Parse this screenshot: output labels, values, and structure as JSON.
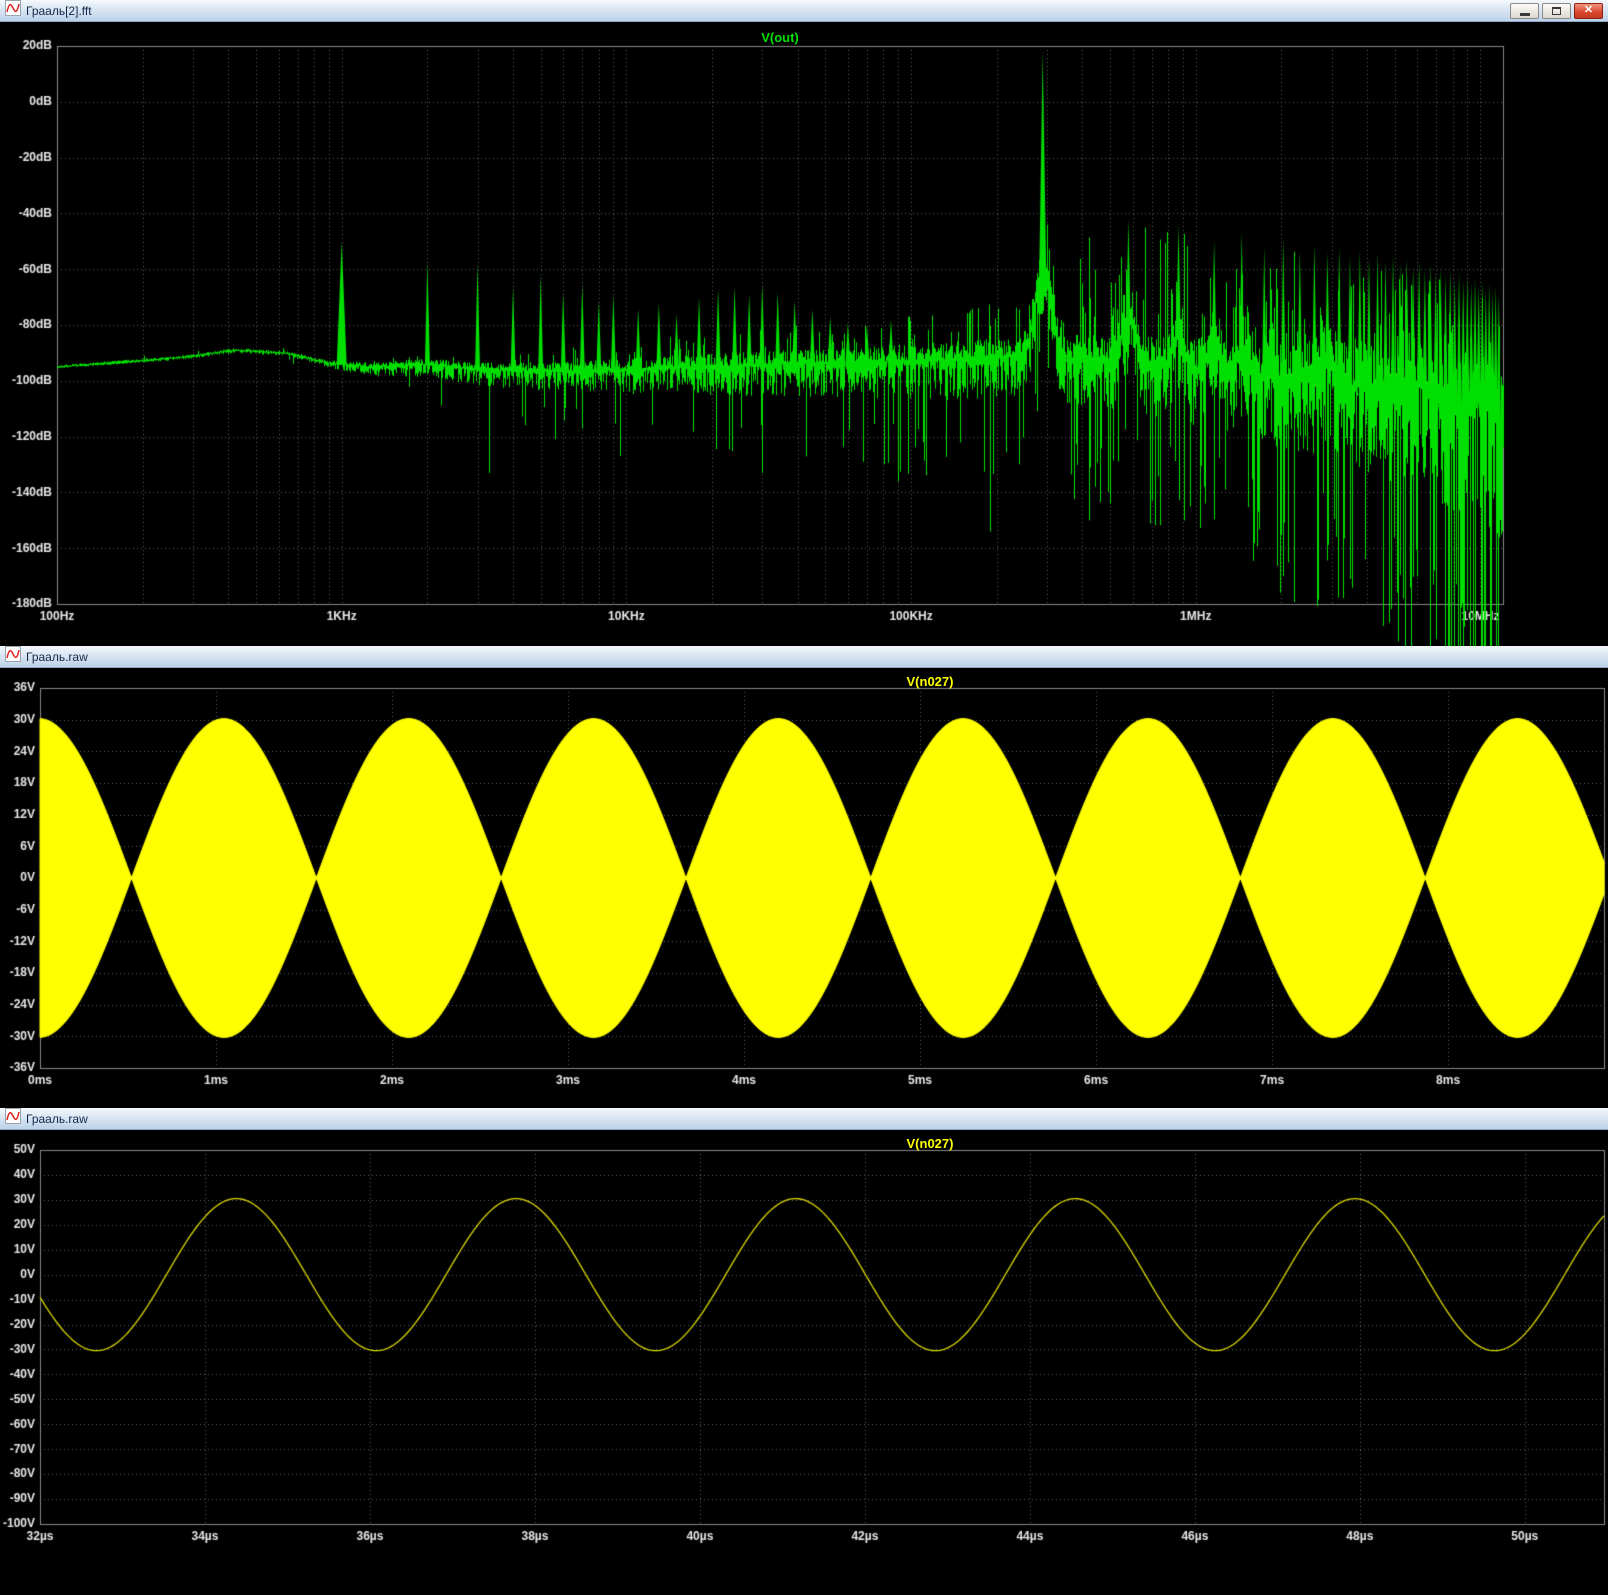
{
  "windows": [
    {
      "title": "Грааль[2].fft"
    },
    {
      "title": "Грааль.raw"
    },
    {
      "title": "Грааль.raw"
    }
  ],
  "window_controls": {
    "close_glyph": "✕"
  },
  "icons": {
    "titlebar": "waveform-icon",
    "minimize": "minimize-icon",
    "restore": "restore-icon",
    "close": "close-icon"
  },
  "chart_data": [
    {
      "type": "line",
      "title": "V(out)",
      "color": "#00e000",
      "x_scale": "log",
      "x_tick_labels": [
        "100Hz",
        "1KHz",
        "10KHz",
        "100KHz",
        "1MHz",
        "10MHz"
      ],
      "x_tick_hz": [
        100,
        1000,
        10000,
        100000,
        1000000,
        10000000
      ],
      "x_range_hz": [
        100,
        12000000
      ],
      "y_tick_labels": [
        "20dB",
        "0dB",
        "-20dB",
        "-40dB",
        "-60dB",
        "-80dB",
        "-100dB",
        "-120dB",
        "-140dB",
        "-160dB",
        "-180dB"
      ],
      "y_tick_db": [
        20,
        0,
        -20,
        -40,
        -60,
        -80,
        -100,
        -120,
        -140,
        -160,
        -180
      ],
      "y_range_db": [
        -180,
        20
      ],
      "grid": "dotted",
      "legend_position": "top-center",
      "carrier_hz": 290000,
      "carrier_db": 18,
      "low_harmonics_hz_db": [
        [
          1000,
          -50
        ],
        [
          2000,
          -57
        ],
        [
          3000,
          -58
        ],
        [
          4000,
          -66
        ],
        [
          5000,
          -62
        ],
        [
          6000,
          -68
        ],
        [
          7000,
          -65
        ],
        [
          8000,
          -71
        ],
        [
          9000,
          -69
        ],
        [
          11000,
          -74
        ],
        [
          13000,
          -72
        ],
        [
          15000,
          -76
        ],
        [
          18000,
          -70
        ],
        [
          21000,
          -67
        ],
        [
          24000,
          -66
        ],
        [
          27000,
          -69
        ],
        [
          30000,
          -65
        ],
        [
          34000,
          -68
        ],
        [
          39000,
          -71
        ],
        [
          45000,
          -74
        ],
        [
          52000,
          -77
        ],
        [
          60000,
          -79
        ],
        [
          70000,
          -80
        ],
        [
          85000,
          -78
        ]
      ],
      "carrier_harmonics_hz_db": [
        [
          580000,
          -42
        ],
        [
          870000,
          -44
        ],
        [
          1160000,
          -50
        ],
        [
          1450000,
          -47
        ],
        [
          1740000,
          -52
        ],
        [
          2030000,
          -49
        ],
        [
          2320000,
          -53
        ],
        [
          2610000,
          -51
        ],
        [
          2900000,
          -54
        ],
        [
          3190000,
          -52
        ],
        [
          3480000,
          -55
        ],
        [
          3770000,
          -53
        ],
        [
          4060000,
          -56
        ],
        [
          4350000,
          -54
        ],
        [
          4640000,
          -57
        ],
        [
          4930000,
          -55
        ],
        [
          5220000,
          -58
        ],
        [
          5510000,
          -56
        ],
        [
          5800000,
          -59
        ],
        [
          6090000,
          -57
        ],
        [
          6380000,
          -60
        ],
        [
          6670000,
          -58
        ],
        [
          6960000,
          -61
        ],
        [
          7250000,
          -59
        ],
        [
          7540000,
          -62
        ],
        [
          7830000,
          -60
        ],
        [
          8120000,
          -63
        ],
        [
          8410000,
          -61
        ],
        [
          8700000,
          -64
        ],
        [
          8990000,
          -62
        ],
        [
          9280000,
          -65
        ],
        [
          9570000,
          -63
        ],
        [
          9860000,
          -66
        ],
        [
          10150000,
          -64
        ],
        [
          10440000,
          -67
        ],
        [
          10730000,
          -65
        ],
        [
          11020000,
          -68
        ],
        [
          11310000,
          -66
        ],
        [
          11600000,
          -69
        ]
      ],
      "deep_spikes_hz_db": [
        [
          3300,
          -133
        ],
        [
          5600,
          -121
        ],
        [
          9500,
          -127
        ],
        [
          30000,
          -133
        ],
        [
          90000,
          -136
        ],
        [
          190000,
          -154
        ],
        [
          420000,
          -150
        ],
        [
          700000,
          -143
        ]
      ],
      "noise_floor_logf_db": [
        [
          2,
          -95
        ],
        [
          2.45,
          -91.5
        ],
        [
          2.62,
          -89
        ],
        [
          2.8,
          -90
        ],
        [
          2.95,
          -93.5
        ],
        [
          3.1,
          -95
        ],
        [
          3.3,
          -94
        ],
        [
          3.5,
          -96
        ],
        [
          3.8,
          -96.5
        ],
        [
          4.2,
          -95
        ],
        [
          4.7,
          -93.5
        ],
        [
          5.1,
          -92.5
        ],
        [
          5.46,
          -91
        ],
        [
          5.85,
          -94
        ],
        [
          6.1,
          -96.5
        ],
        [
          6.4,
          -99.5
        ],
        [
          6.7,
          -104
        ],
        [
          6.95,
          -111
        ],
        [
          7.08,
          -117
        ]
      ],
      "fuzz_spread_logf_up_dn": [
        [
          2,
          0.6,
          0.6
        ],
        [
          2.9,
          0.8,
          1.2
        ],
        [
          3.05,
          1.5,
          3
        ],
        [
          3.5,
          2.5,
          6
        ],
        [
          4,
          4,
          9
        ],
        [
          4.6,
          5,
          12
        ],
        [
          5,
          6,
          14
        ],
        [
          5.46,
          8,
          16
        ],
        [
          5.9,
          10,
          20
        ],
        [
          6.3,
          12,
          26
        ],
        [
          6.7,
          15,
          33
        ],
        [
          7.08,
          18,
          44
        ]
      ],
      "deep_spike_prob_logf_p": [
        [
          2,
          0
        ],
        [
          3.2,
          0.02
        ],
        [
          4,
          0.05
        ],
        [
          4.8,
          0.08
        ],
        [
          5.5,
          0.12
        ],
        [
          6,
          0.16
        ],
        [
          6.5,
          0.22
        ],
        [
          7.08,
          0.3
        ]
      ],
      "up_spike_prob_logf_p": [
        [
          2,
          0
        ],
        [
          3.3,
          0.04
        ],
        [
          4,
          0.1
        ],
        [
          4.7,
          0.12
        ],
        [
          5.2,
          0.15
        ],
        [
          5.8,
          0.22
        ],
        [
          6.2,
          0.3
        ],
        [
          6.6,
          0.38
        ],
        [
          7.08,
          0.45
        ]
      ],
      "comb_envelope_logf_db": [
        [
          5.46,
          -40
        ],
        [
          5.76,
          -43
        ],
        [
          6.06,
          -49
        ],
        [
          6.36,
          -54
        ],
        [
          6.66,
          -59
        ],
        [
          6.9,
          -63
        ],
        [
          7.08,
          -66
        ]
      ],
      "skirt_bumps_logf_amp_w": [
        [
          5.462,
          30,
          0.04
        ],
        [
          5.763,
          14,
          0.035
        ],
        [
          5.938,
          12,
          0.03
        ],
        [
          6.064,
          9,
          0.03
        ],
        [
          6.161,
          8,
          0.03
        ],
        [
          6.462,
          7,
          0.04
        ],
        [
          6.763,
          6,
          0.05
        ],
        [
          7.0,
          6,
          0.05
        ]
      ]
    },
    {
      "type": "area",
      "title": "V(n027)",
      "color": "#ffff00",
      "x_tick_labels": [
        "0ms",
        "1ms",
        "2ms",
        "3ms",
        "4ms",
        "5ms",
        "6ms",
        "7ms",
        "8ms"
      ],
      "x_tick_ms": [
        0,
        1,
        2,
        3,
        4,
        5,
        6,
        7,
        8
      ],
      "x_range_ms": [
        0,
        8.886
      ],
      "y_tick_labels": [
        "36V",
        "30V",
        "24V",
        "18V",
        "12V",
        "6V",
        "0V",
        "-6V",
        "-12V",
        "-18V",
        "-24V",
        "-30V",
        "-36V"
      ],
      "y_tick_v": [
        36,
        30,
        24,
        18,
        12,
        6,
        0,
        -6,
        -12,
        -18,
        -24,
        -30,
        -36
      ],
      "y_range_v": [
        -36,
        36
      ],
      "grid": "dotted",
      "signal": {
        "kind": "am_beat_envelope",
        "envelope_amplitude_v": 30.2,
        "envelope_node_spacing_ms": 1.05,
        "envelope_first_node_ms": 0.52
      }
    },
    {
      "type": "line",
      "title": "V(n027)",
      "color": "#d8d800",
      "x_tick_labels": [
        "32µs",
        "34µs",
        "36µs",
        "38µs",
        "40µs",
        "42µs",
        "44µs",
        "46µs",
        "48µs",
        "50µs"
      ],
      "x_tick_us": [
        32,
        34,
        36,
        38,
        40,
        42,
        44,
        46,
        48,
        50
      ],
      "x_range_us": [
        32,
        50.96
      ],
      "y_tick_labels": [
        "50V",
        "40V",
        "30V",
        "20V",
        "10V",
        "0V",
        "-10V",
        "-20V",
        "-30V",
        "-40V",
        "-50V",
        "-60V",
        "-70V",
        "-80V",
        "-90V",
        "-100V"
      ],
      "y_tick_v": [
        50,
        40,
        30,
        20,
        10,
        0,
        -10,
        -20,
        -30,
        -40,
        -50,
        -60,
        -70,
        -80,
        -90,
        -100
      ],
      "y_range_v": [
        -100,
        50
      ],
      "grid": "dotted",
      "signal": {
        "kind": "sine",
        "amplitude_v": 30.5,
        "period_us": 3.39,
        "peak_at_us": 34.38
      }
    }
  ]
}
